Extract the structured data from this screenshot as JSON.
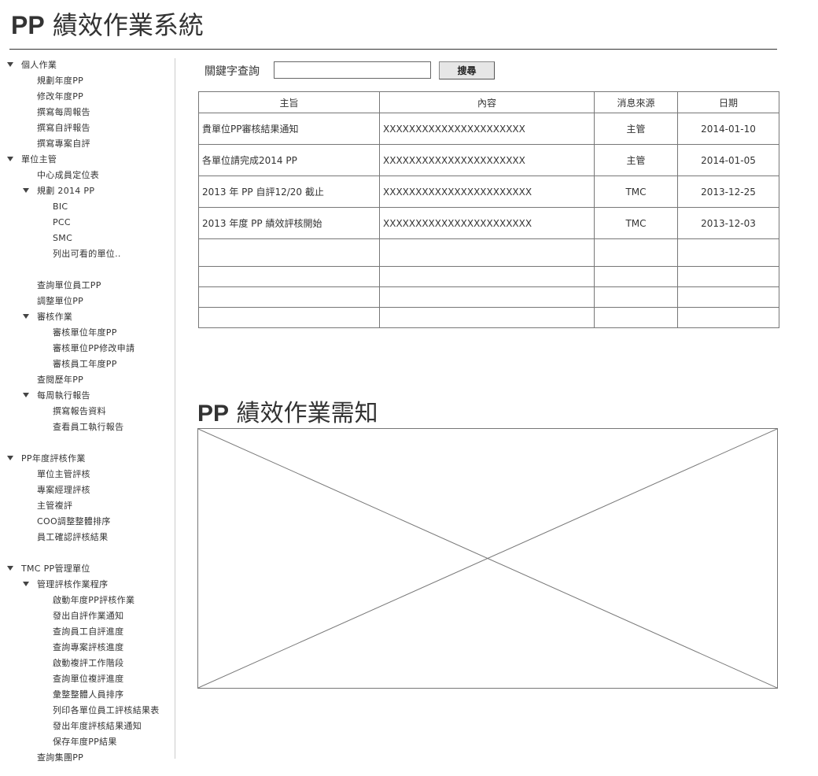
{
  "header": {
    "title_prefix": "PP",
    "title_rest": " 績效作業系統"
  },
  "sidebar": {
    "items": [
      {
        "label": "個人作業",
        "toggle": true
      },
      {
        "label": "規劃年度PP"
      },
      {
        "label": "修改年度PP"
      },
      {
        "label": "撰寫每周報告"
      },
      {
        "label": "撰寫自評報告"
      },
      {
        "label": "撰寫專案自評"
      },
      {
        "label": "單位主管",
        "toggle": true
      },
      {
        "label": "中心成員定位表"
      },
      {
        "label": "規劃 2014 PP",
        "toggle": true
      },
      {
        "label": "BIC"
      },
      {
        "label": "PCC"
      },
      {
        "label": "SMC"
      },
      {
        "label": "列出可看的單位.."
      },
      {
        "label": "查詢單位員工PP"
      },
      {
        "label": "調整單位PP"
      },
      {
        "label": "審核作業",
        "toggle": true
      },
      {
        "label": "審核單位年度PP"
      },
      {
        "label": "審核單位PP修改申請"
      },
      {
        "label": "審核員工年度PP"
      },
      {
        "label": "查閱歷年PP"
      },
      {
        "label": "每周執行報告",
        "toggle": true
      },
      {
        "label": "撰寫報告資料"
      },
      {
        "label": "查看員工執行報告"
      },
      {
        "label": "PP年度評核作業",
        "toggle": true
      },
      {
        "label": "單位主管評核"
      },
      {
        "label": "專案經理評核"
      },
      {
        "label": "主管複評"
      },
      {
        "label": "COO調整整體排序"
      },
      {
        "label": "員工確認評核結果"
      },
      {
        "label": "TMC PP管理單位",
        "toggle": true
      },
      {
        "label": "管理評核作業程序",
        "toggle": true
      },
      {
        "label": "啟動年度PP評核作業"
      },
      {
        "label": "發出自評作業通知"
      },
      {
        "label": "查詢員工自評進度"
      },
      {
        "label": "查詢專案評核進度"
      },
      {
        "label": "啟動複評工作階段"
      },
      {
        "label": "查詢單位複評進度"
      },
      {
        "label": "彙整整體人員排序"
      },
      {
        "label": "列印各單位員工評核結果表"
      },
      {
        "label": "發出年度評核結果通知"
      },
      {
        "label": "保存年度PP結果"
      },
      {
        "label": "查詢集團PP"
      }
    ]
  },
  "search": {
    "label": "關鍵字查詢",
    "value": "",
    "button_label": "搜尋"
  },
  "table": {
    "headers": [
      "主旨",
      "內容",
      "消息來源",
      "日期"
    ],
    "rows": [
      [
        "貴單位PP審核結果通知",
        "XXXXXXXXXXXXXXXXXXXXXX",
        "主管",
        "2014-01-10"
      ],
      [
        "各單位請完成2014 PP",
        "XXXXXXXXXXXXXXXXXXXXXX",
        "主管",
        "2014-01-05"
      ],
      [
        "2013 年 PP 自評12/20 截止",
        "XXXXXXXXXXXXXXXXXXXXXXX",
        "TMC",
        "2013-12-25"
      ],
      [
        "2013 年度 PP 績效評核開始",
        "XXXXXXXXXXXXXXXXXXXXXXX",
        "TMC",
        "2013-12-03"
      ]
    ]
  },
  "notice": {
    "title_prefix": "PP",
    "title_rest": " 績效作業需知"
  },
  "colors": {
    "text": "#333333",
    "border": "#777777",
    "button_bg": "#e6e6e6"
  }
}
